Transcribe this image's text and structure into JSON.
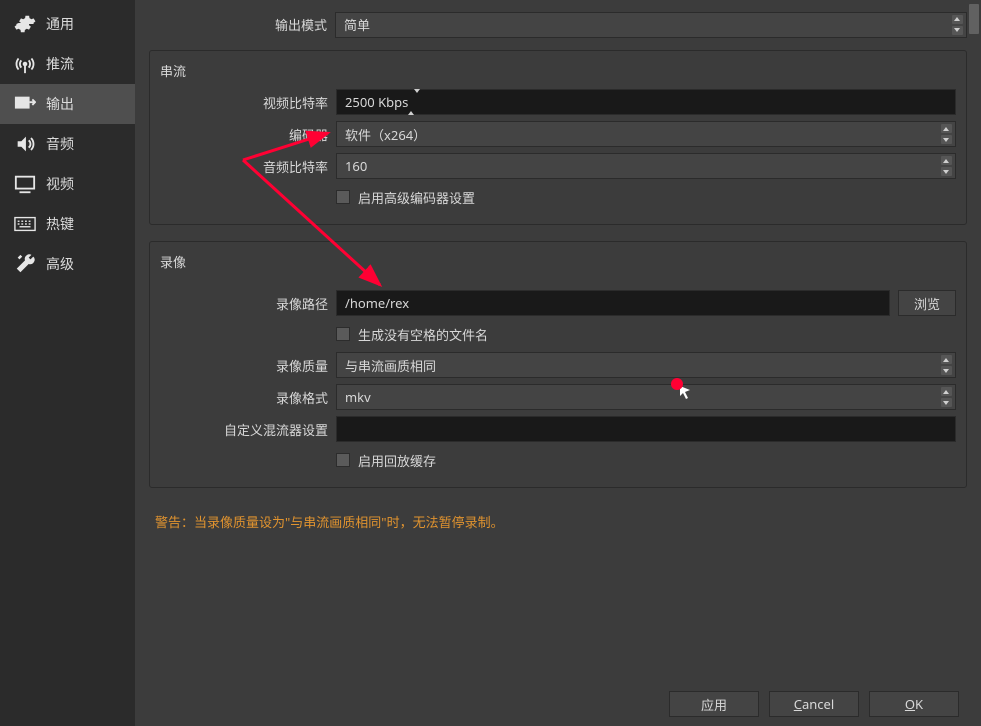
{
  "sidebar": {
    "items": [
      {
        "label": "通用",
        "icon": "gear-icon"
      },
      {
        "label": "推流",
        "icon": "antenna-icon"
      },
      {
        "label": "输出",
        "icon": "output-icon"
      },
      {
        "label": "音频",
        "icon": "speaker-icon"
      },
      {
        "label": "视频",
        "icon": "monitor-icon"
      },
      {
        "label": "热键",
        "icon": "keyboard-icon"
      },
      {
        "label": "高级",
        "icon": "tools-icon"
      }
    ]
  },
  "output_mode": {
    "label": "输出模式",
    "value": "简单"
  },
  "stream": {
    "title": "串流",
    "video_bitrate": {
      "label": "视频比特率",
      "value": "2500 Kbps"
    },
    "encoder": {
      "label": "编码器",
      "value": "软件（x264）"
    },
    "audio_bitrate": {
      "label": "音频比特率",
      "value": "160"
    },
    "advanced": {
      "label": "启用高级编码器设置",
      "checked": false
    }
  },
  "record": {
    "title": "录像",
    "path": {
      "label": "录像路径",
      "value": "/home/rex",
      "browse": "浏览"
    },
    "no_space": {
      "label": "生成没有空格的文件名",
      "checked": false
    },
    "quality": {
      "label": "录像质量",
      "value": "与串流画质相同"
    },
    "format": {
      "label": "录像格式",
      "value": "mkv"
    },
    "muxer": {
      "label": "自定义混流器设置",
      "value": ""
    },
    "replay_buffer": {
      "label": "启用回放缓存",
      "checked": false
    }
  },
  "warning": "警告：当录像质量设为\"与串流画质相同\"时，无法暂停录制。",
  "footer": {
    "apply": "应用",
    "cancel": "Cancel",
    "ok": "OK"
  }
}
